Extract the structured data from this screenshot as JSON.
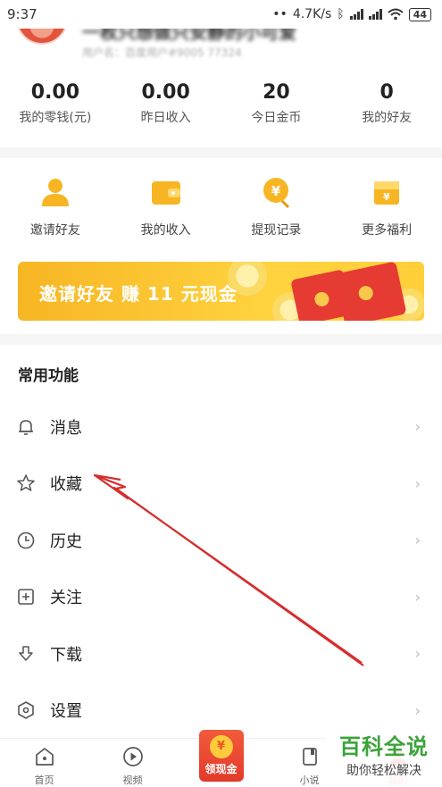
{
  "status_bar": {
    "time": "9:37",
    "speed": "4.7K/s",
    "battery": "44"
  },
  "profile": {
    "name": "一枚只想做只安静的小可爱",
    "user_id": "用户名：百度用户#9005 77324"
  },
  "stats": [
    {
      "value": "0.00",
      "label": "我的零钱(元)"
    },
    {
      "value": "0.00",
      "label": "昨日收入"
    },
    {
      "value": "20",
      "label": "今日金币"
    },
    {
      "value": "0",
      "label": "我的好友"
    }
  ],
  "quick_actions": [
    {
      "label": "邀请好友",
      "icon": "person-icon"
    },
    {
      "label": "我的收入",
      "icon": "wallet-icon"
    },
    {
      "label": "提现记录",
      "icon": "yen-coin-icon"
    },
    {
      "label": "更多福利",
      "icon": "gift-card-icon"
    }
  ],
  "banner": {
    "text": "邀请好友 赚 11 元现金"
  },
  "functions": {
    "title": "常用功能",
    "items": [
      {
        "label": "消息",
        "icon": "bell-icon"
      },
      {
        "label": "收藏",
        "icon": "star-icon"
      },
      {
        "label": "历史",
        "icon": "clock-icon"
      },
      {
        "label": "关注",
        "icon": "plus-square-icon"
      },
      {
        "label": "下载",
        "icon": "download-icon"
      },
      {
        "label": "设置",
        "icon": "settings-hex-icon"
      }
    ],
    "chevron": "›"
  },
  "tabbar": {
    "tabs": [
      {
        "label": "首页",
        "icon": "home-icon"
      },
      {
        "label": "视频",
        "icon": "play-icon"
      },
      {
        "label": "领现金",
        "icon": "cash-coin-icon"
      },
      {
        "label": "小说",
        "icon": "book-icon"
      },
      {
        "label": "我的",
        "icon": "profile-icon"
      }
    ],
    "cash_symbol": "¥"
  },
  "watermark": {
    "title": "百科全说",
    "subtitle": "助你轻松解决"
  },
  "colors": {
    "accent": "#f7b523",
    "annotation": "#d62d2d",
    "watermark": "#3aa33a"
  }
}
